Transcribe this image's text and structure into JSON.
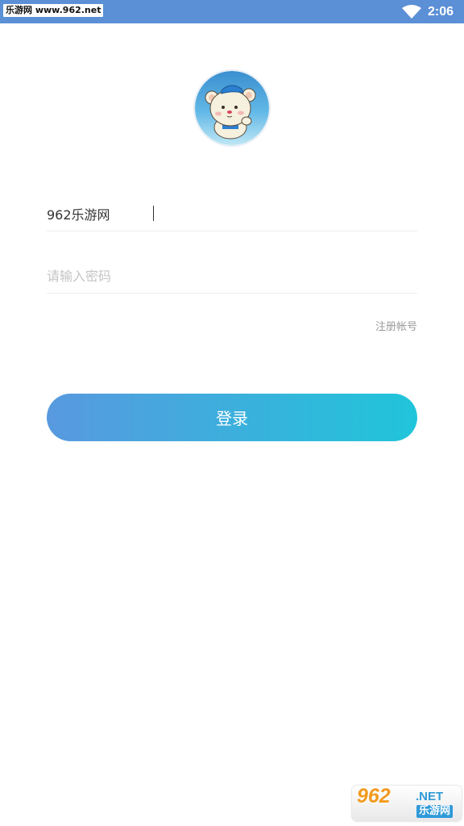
{
  "status_bar": {
    "watermark_text": "乐游网 www.962.net",
    "time": "2:06",
    "wifi_icon": "wifi-icon",
    "background_color": "#5b8fd6"
  },
  "avatar": {
    "icon": "bear-avatar-icon"
  },
  "login_form": {
    "username_value": "962乐游网",
    "password_value": "",
    "password_placeholder": "请输入密码",
    "register_label": "注册帐号",
    "login_label": "登录",
    "button_gradient_start": "#5899df",
    "button_gradient_end": "#20c5da"
  },
  "watermark": {
    "number": "962",
    "net": ".NET",
    "name": "乐游网"
  }
}
